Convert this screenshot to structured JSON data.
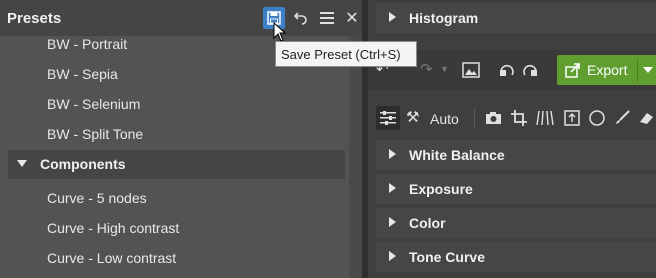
{
  "presets_panel": {
    "title": "Presets",
    "items": [
      "BW - Portrait",
      "BW - Sepia",
      "BW - Selenium",
      "BW - Split Tone"
    ],
    "group": {
      "label": "Components",
      "items": [
        "Curve - 5 nodes",
        "Curve - High contrast",
        "Curve - Low contrast"
      ]
    }
  },
  "tooltip": {
    "text": "Save Preset (Ctrl+S)"
  },
  "right_panel": {
    "sections": [
      "Histogram",
      "White Balance",
      "Exposure",
      "Color",
      "Tone Curve"
    ],
    "export_label": "Export",
    "auto_label": "Auto"
  },
  "colors": {
    "accent_blue": "#3c7fc7",
    "export_green": "#5f9e2f"
  }
}
